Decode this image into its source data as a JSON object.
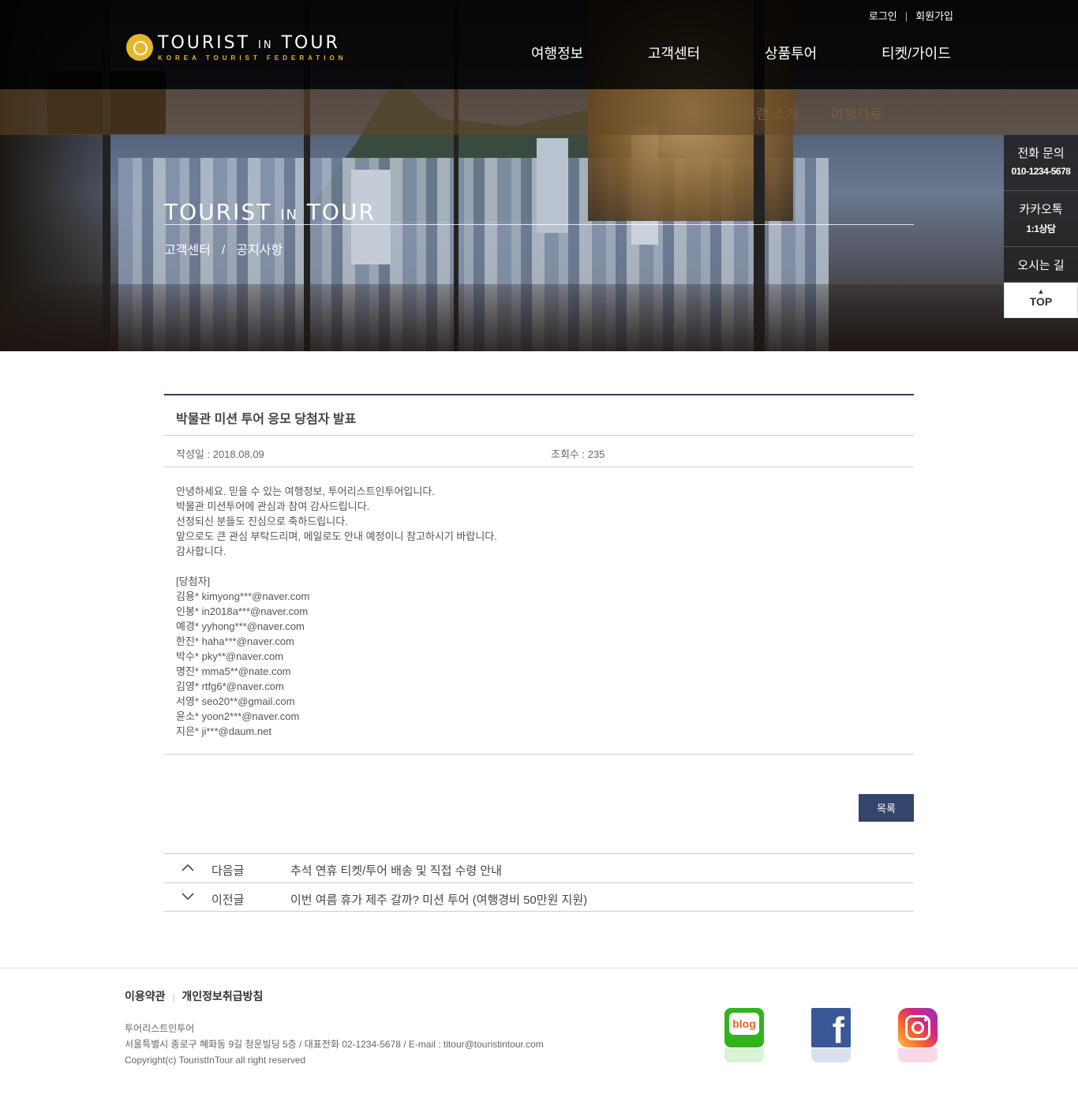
{
  "header": {
    "logo_main": "TOURIST",
    "logo_in": "IN",
    "logo_tour": "TOUR",
    "logo_sub": "KOREA TOURIST FEDERATION",
    "util": {
      "login": "로그인",
      "signup": "회원가입"
    },
    "gnb": [
      "여행정보",
      "고객센터",
      "상품투어",
      "티켓/가이드"
    ],
    "subnav": [
      "프로그램 소개",
      "여행자료"
    ]
  },
  "hero": {
    "title_main": "TOURIST",
    "title_in": "IN",
    "title_tour": "TOUR",
    "breadcrumb": [
      "고객센터",
      "공지사항"
    ],
    "breadcrumb_sep": "/"
  },
  "quick_menu": {
    "phone_label": "전화 문의",
    "phone_number": "010-1234-5678",
    "kakao_label": "카카오톡",
    "kakao_sub": "1:1상담",
    "directions": "오시는 길",
    "top": "TOP"
  },
  "article": {
    "title": "박물관 미션 투어 응모 당첨자 발표",
    "date": "작성일 : 2018.08.09",
    "views": "조회수 : 235",
    "body": [
      "안녕하세요. 믿을 수 있는 여행정보, 투어리스트인투어입니다.",
      "박물관 미션투어에 관심과 참여 감사드립니다.",
      "선정되신 분들도 진심으로 축하드립니다.",
      "앞으로도 큰 관심 부탁드리며, 메일로도 안내 예정이니 참고하시기 바랍니다.",
      "감사합니다.",
      "",
      "[당첨자]",
      "김용* kimyong***@naver.com",
      "인봉* in2018a***@naver.com",
      "예경* yyhong***@naver.com",
      "한진* haha***@naver.com",
      "박수* pky**@naver.com",
      "명진* mma5**@nate.com",
      "김영* rtfg6*@naver.com",
      "서영* seo20**@gmail.com",
      "윤소* yoon2***@naver.com",
      "지은* ji***@daum.net"
    ],
    "list_button": "목록"
  },
  "prev_next": {
    "next_label": "다음글",
    "next_title": "추석 연휴 티켓/투어 배송 및 직접 수령 안내",
    "prev_label": "이전글",
    "prev_title": "이번 여름 휴가 제주 갈까? 미션 투어 (여행경비 50만원 지원)"
  },
  "footer": {
    "terms": "이용약관",
    "privacy": "개인정보취급방침",
    "company": "투어리스트인투어",
    "address": "서울특별시 종로구 혜화동 9길 청운빌딩 5층 / 대표전화 02-1234-5678 / E-mail : titour@touristintour.com",
    "copyright": "Copyright(c) TouristInTour all right reserved",
    "blog_label": "blog",
    "fb_label": "f"
  },
  "colors": {
    "accent": "#33456b",
    "logo": "#e8b62a"
  },
  "icons": [
    "logo-icon",
    "chevron-up-icon",
    "chevron-down-icon",
    "blog-icon",
    "facebook-icon",
    "instagram-icon",
    "top-arrow-icon"
  ]
}
